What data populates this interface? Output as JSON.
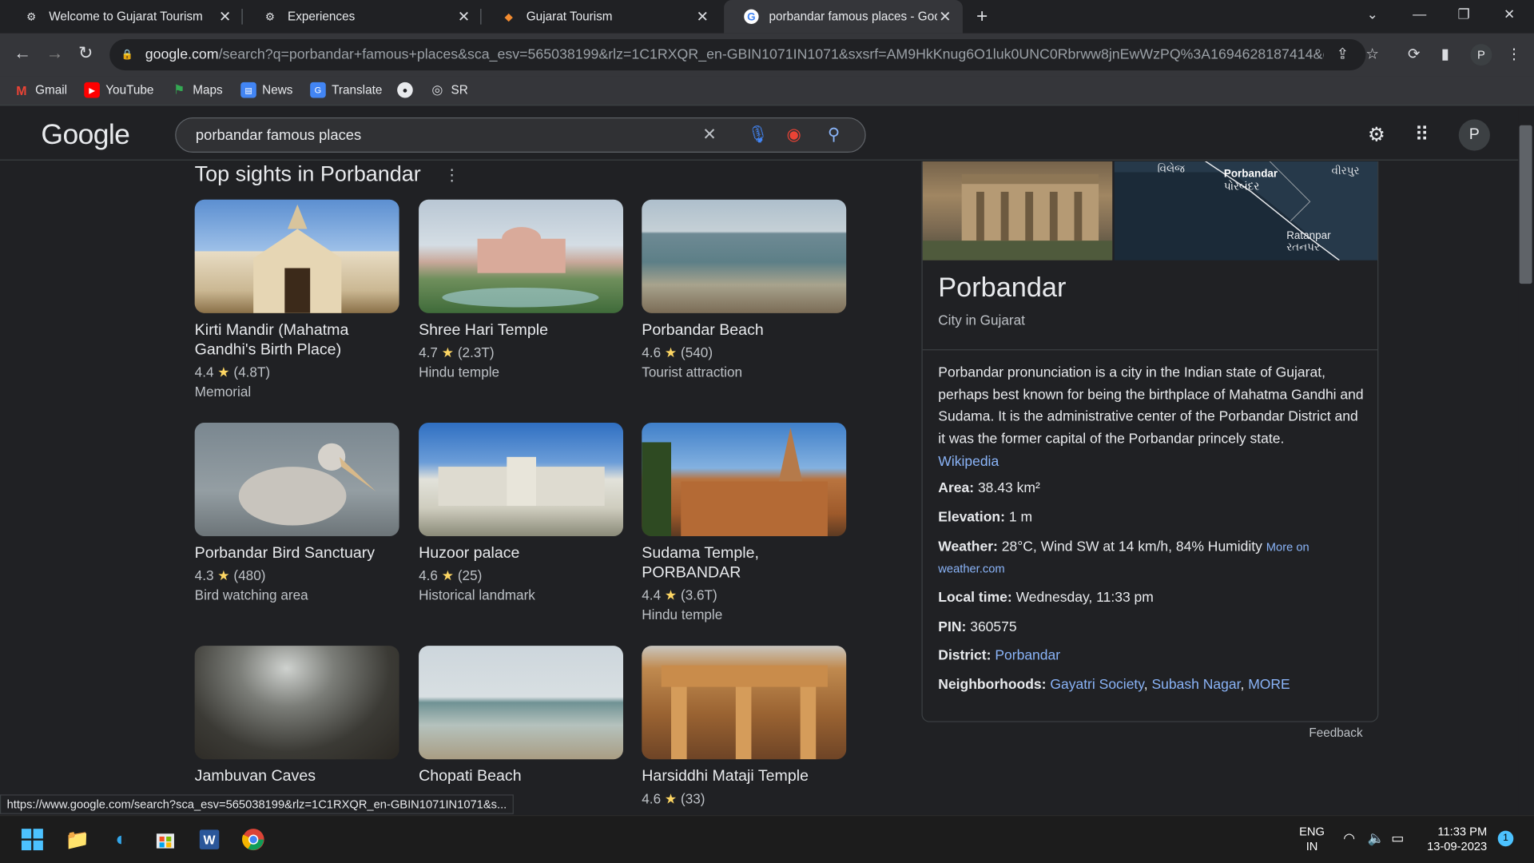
{
  "browser": {
    "tabs": [
      {
        "label": "Welcome to Gujarat Tourism",
        "icon": "chrome-icon"
      },
      {
        "label": "Experiences",
        "icon": "chrome-icon"
      },
      {
        "label": "Gujarat Tourism",
        "icon": "gujarat-tourism-icon"
      },
      {
        "label": "porbandar famous places - Goog",
        "icon": "google-icon"
      }
    ],
    "url_host": "google.com",
    "url_rest": "/search?q=porbandar+famous+places&sca_esv=565038199&rlz=1C1RXQR_en-GBIN1071IN1071&sxsrf=AM9HkKnug6O1luk0UNC0Rbrww8jnEwWzPQ%3A1694628187414&ei=W...",
    "profile_initial": "P",
    "bookmarks": [
      "Gmail",
      "YouTube",
      "Maps",
      "News",
      "Translate",
      "",
      "SR"
    ]
  },
  "google": {
    "logo": "Google",
    "query": "porbandar famous places",
    "profile_initial": "P"
  },
  "sights": {
    "title": "Top sights in Porbandar",
    "items": [
      {
        "name": "Kirti Mandir (Mahatma Gandhi's Birth Place)",
        "rating": "4.4",
        "reviews": "(4.8T)",
        "type": "Memorial"
      },
      {
        "name": "Shree Hari Temple",
        "rating": "4.7",
        "reviews": "(2.3T)",
        "type": "Hindu temple"
      },
      {
        "name": "Porbandar Beach",
        "rating": "4.6",
        "reviews": "(540)",
        "type": "Tourist attraction"
      },
      {
        "name": "Porbandar Bird Sanctuary",
        "rating": "4.3",
        "reviews": "(480)",
        "type": "Bird watching area"
      },
      {
        "name": "Huzoor palace",
        "rating": "4.6",
        "reviews": "(25)",
        "type": "Historical landmark"
      },
      {
        "name": "Sudama Temple, PORBANDAR",
        "rating": "4.4",
        "reviews": "(3.6T)",
        "type": "Hindu temple"
      },
      {
        "name": "Jambuvan Caves",
        "rating": "",
        "reviews": "",
        "type": ""
      },
      {
        "name": "Chopati Beach",
        "rating": "",
        "reviews": "",
        "type": ""
      },
      {
        "name": "Harsiddhi Mataji Temple",
        "rating": "4.6",
        "reviews": "(33)",
        "type": ""
      }
    ]
  },
  "knowledge_panel": {
    "title": "Porbandar",
    "subtitle": "City in Gujarat",
    "map_labels": [
      "Porbandar",
      "પોરબંદર",
      "Ratanpar",
      "રતનપર",
      "વીરપુર",
      "વિલેજ"
    ],
    "description": "Porbandar pronunciation is a city in the Indian state of Gujarat, perhaps best known for being the birthplace of Mahatma Gandhi and Sudama. It is the administrative center of the Porbandar District and it was the former capital of the Porbandar princely state.",
    "source_link": "Wikipedia",
    "area_label": "Area:",
    "area": "38.43 km²",
    "elevation_label": "Elevation:",
    "elevation": "1 m",
    "weather_label": "Weather:",
    "weather": "28°C, Wind SW at 14 km/h, 84% Humidity",
    "weather_link": "More on weather.com",
    "localtime_label": "Local time:",
    "localtime": "Wednesday, 11:33 pm",
    "pin_label": "PIN:",
    "pin": "360575",
    "district_label": "District:",
    "district": "Porbandar",
    "neighborhoods_label": "Neighborhoods:",
    "neighborhoods": [
      "Gayatri Society",
      "Subash Nagar",
      "MORE"
    ],
    "feedback": "Feedback"
  },
  "status_url": "https://www.google.com/search?sca_esv=565038199&rlz=1C1RXQR_en-GBIN1071IN1071&s...",
  "taskbar": {
    "lang": "ENG",
    "region": "IN",
    "time": "11:33 PM",
    "date": "13-09-2023",
    "notification_count": "1"
  },
  "colors": {
    "accent_link": "#8ab4f8",
    "star": "#fdd663",
    "background": "#202124"
  }
}
